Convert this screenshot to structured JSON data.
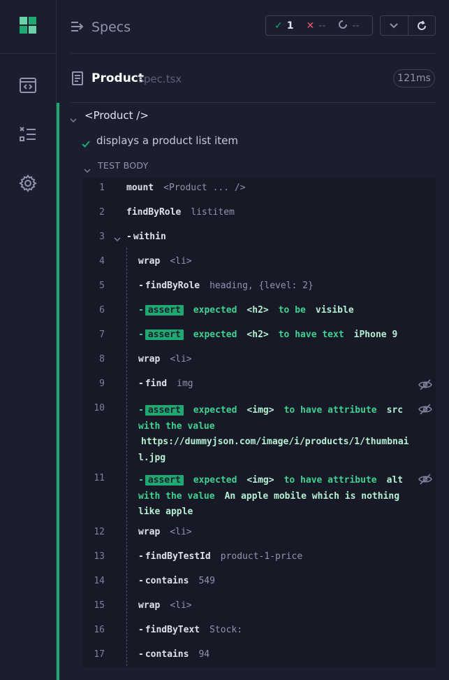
{
  "sidebar": {
    "logo": "cypress-logo",
    "icons": [
      "code-window-icon",
      "test-list-icon",
      "gear-icon"
    ]
  },
  "header": {
    "title": "Specs",
    "stats": {
      "passed": "1",
      "failed": "--",
      "pending": "--"
    },
    "colors": {
      "passed": "#1fa971",
      "failed": "#e45770",
      "pending": "#9095ad"
    }
  },
  "spec": {
    "name": "Product",
    "ext": "spec.tsx",
    "duration": "121ms"
  },
  "suite": {
    "title": "<Product />",
    "test_title": "displays a product list item",
    "body_label": "TEST BODY"
  },
  "commands": [
    {
      "n": "1",
      "name": "mount",
      "arg": "<Product ... />"
    },
    {
      "n": "2",
      "name": "findByRole",
      "arg": "listitem"
    },
    {
      "n": "3",
      "name": "within",
      "arg": ""
    },
    {
      "n": "4",
      "name": "wrap",
      "arg": "<li>"
    },
    {
      "n": "5",
      "name": "findByRole",
      "arg": "heading, {level: 2}"
    },
    {
      "n": "6",
      "badge": "assert",
      "p1": "expected",
      "p2": "<h2>",
      "p3": "to be",
      "p4": "visible"
    },
    {
      "n": "7",
      "badge": "assert",
      "p1": "expected",
      "p2": "<h2>",
      "p3": "to have text",
      "p4": "iPhone 9"
    },
    {
      "n": "8",
      "name": "wrap",
      "arg": "<li>"
    },
    {
      "n": "9",
      "name": "find",
      "arg": "img"
    },
    {
      "n": "10",
      "badge": "assert",
      "p1": "expected",
      "p2": "<img>",
      "p3": "to have attribute",
      "p4": "src",
      "p5": "with the value",
      "p6": "https://dummyjson.com/image/i/products/1/thumbnail.jpg"
    },
    {
      "n": "11",
      "badge": "assert",
      "p1": "expected",
      "p2": "<img>",
      "p3": "to have attribute",
      "p4": "alt",
      "p5": "with the value",
      "p6": "An apple mobile which is nothing like apple"
    },
    {
      "n": "12",
      "name": "wrap",
      "arg": "<li>"
    },
    {
      "n": "13",
      "name": "findByTestId",
      "arg": "product-1-price"
    },
    {
      "n": "14",
      "name": "contains",
      "arg": "549"
    },
    {
      "n": "15",
      "name": "wrap",
      "arg": "<li>"
    },
    {
      "n": "16",
      "name": "findByText",
      "arg": "Stock:"
    },
    {
      "n": "17",
      "name": "contains",
      "arg": "94"
    }
  ]
}
